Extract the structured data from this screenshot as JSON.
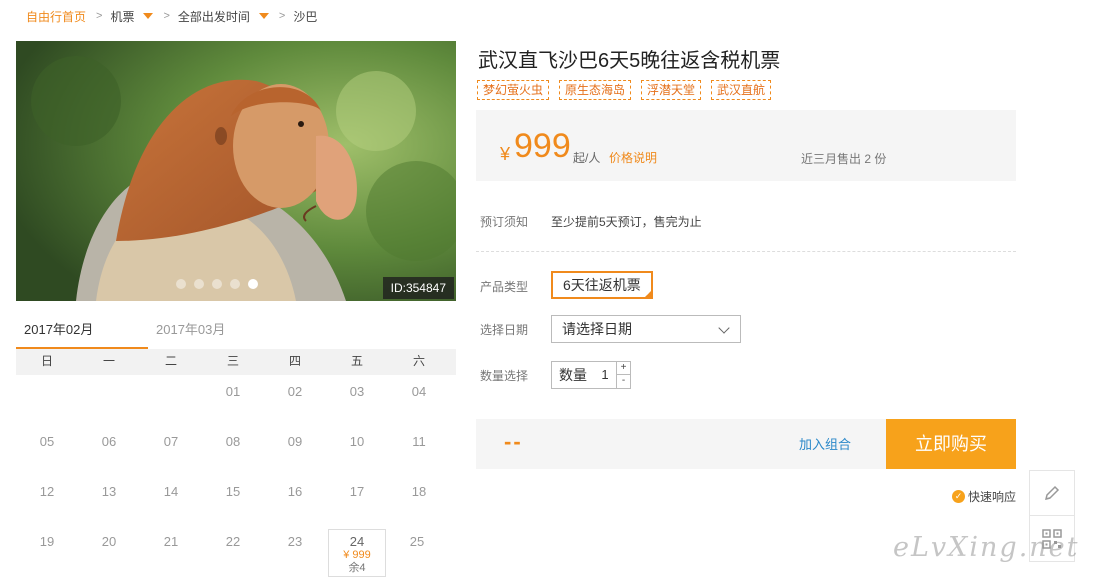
{
  "breadcrumb": {
    "home": "自由行首页",
    "items": [
      "机票",
      "全部出发时间",
      "沙巴"
    ]
  },
  "product": {
    "image_id": "ID:354847",
    "image_subject": "proboscis-monkey",
    "slide_count": 5,
    "active_slide": 5,
    "title": "武汉直飞沙巴6天5晚往返含税机票",
    "tags": [
      "梦幻萤火虫",
      "原生态海岛",
      "浮潜天堂",
      "武汉直航"
    ]
  },
  "price": {
    "currency": "¥",
    "amount": "999",
    "unit": "起/人",
    "explain_label": "价格说明",
    "sold_text": "近三月售出 2 份"
  },
  "booking": {
    "notice_label": "预订须知",
    "notice_text": "至少提前5天预订，售完为止",
    "type_label": "产品类型",
    "type_value": "6天往返机票",
    "date_label": "选择日期",
    "date_placeholder": "请选择日期",
    "qty_label": "数量选择",
    "qty_inner_label": "数量",
    "qty_value": "1",
    "plus": "+",
    "minus": "-"
  },
  "purchase": {
    "total": "--",
    "add_combo": "加入组合",
    "buy_now": "立即购买",
    "quick_response": "快速响应"
  },
  "calendar": {
    "tabs": [
      "2017年02月",
      "2017年03月"
    ],
    "active_tab": 0,
    "weekdays": [
      "日",
      "一",
      "二",
      "三",
      "四",
      "五",
      "六"
    ],
    "weeks": [
      [
        "",
        "",
        "",
        "01",
        "02",
        "03",
        "04"
      ],
      [
        "05",
        "06",
        "07",
        "08",
        "09",
        "10",
        "11"
      ],
      [
        "12",
        "13",
        "14",
        "15",
        "16",
        "17",
        "18"
      ],
      [
        "19",
        "20",
        "21",
        "22",
        "23",
        "24",
        "25"
      ]
    ],
    "available": {
      "day": "24",
      "price": "¥ 999",
      "left": "余4"
    }
  },
  "watermark": "eLvXing.net",
  "colors": {
    "accent": "#f08a1c",
    "buy_button": "#f7a21b",
    "link": "#2a88c9"
  }
}
